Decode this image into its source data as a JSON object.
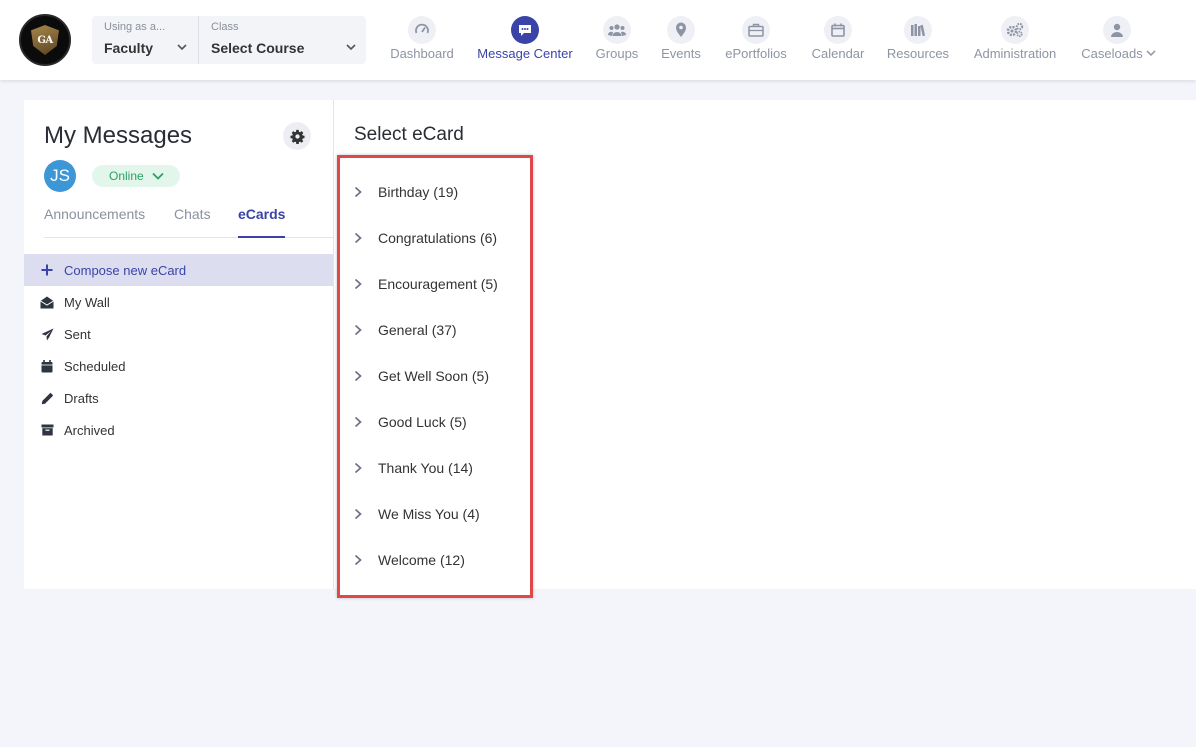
{
  "header": {
    "role_selector": {
      "label": "Using as a...",
      "value": "Faculty"
    },
    "class_selector": {
      "label": "Class",
      "value": "Select Course"
    },
    "nav": [
      {
        "id": "dashboard",
        "label": "Dashboard",
        "icon": "speedometer-icon"
      },
      {
        "id": "message-center",
        "label": "Message Center",
        "icon": "chat-bubble-icon",
        "active": true
      },
      {
        "id": "groups",
        "label": "Groups",
        "icon": "people-icon"
      },
      {
        "id": "events",
        "label": "Events",
        "icon": "map-pin-icon"
      },
      {
        "id": "eportfolios",
        "label": "ePortfolios",
        "icon": "briefcase-icon"
      },
      {
        "id": "calendar",
        "label": "Calendar",
        "icon": "calendar-icon"
      },
      {
        "id": "resources",
        "label": "Resources",
        "icon": "books-icon"
      },
      {
        "id": "administration",
        "label": "Administration",
        "icon": "gears-icon"
      },
      {
        "id": "caseloads",
        "label": "Caseloads",
        "icon": "user-icon"
      }
    ]
  },
  "sidebar": {
    "title": "My Messages",
    "avatar_initials": "JS",
    "status": "Online",
    "tabs": [
      {
        "label": "Announcements"
      },
      {
        "label": "Chats"
      },
      {
        "label": "eCards",
        "active": true
      }
    ],
    "items": [
      {
        "label": "Compose new eCard",
        "icon": "plus-icon",
        "active": true
      },
      {
        "label": "My Wall",
        "icon": "envelope-open-icon"
      },
      {
        "label": "Sent",
        "icon": "paper-plane-icon"
      },
      {
        "label": "Scheduled",
        "icon": "calendar-icon"
      },
      {
        "label": "Drafts",
        "icon": "pencil-icon"
      },
      {
        "label": "Archived",
        "icon": "archive-icon"
      }
    ]
  },
  "main": {
    "title": "Select eCard",
    "categories": [
      {
        "label": "Birthday (19)"
      },
      {
        "label": "Congratulations (6)"
      },
      {
        "label": "Encouragement (5)"
      },
      {
        "label": "General (37)"
      },
      {
        "label": "Get Well Soon (5)"
      },
      {
        "label": "Good Luck (5)"
      },
      {
        "label": "Thank You (14)"
      },
      {
        "label": "We Miss You (4)"
      },
      {
        "label": "Welcome (12)"
      }
    ]
  },
  "colors": {
    "accent": "#3a43a8",
    "highlight_border": "#e04848",
    "online_green": "#2aa160",
    "avatar_blue": "#3d96d6"
  }
}
